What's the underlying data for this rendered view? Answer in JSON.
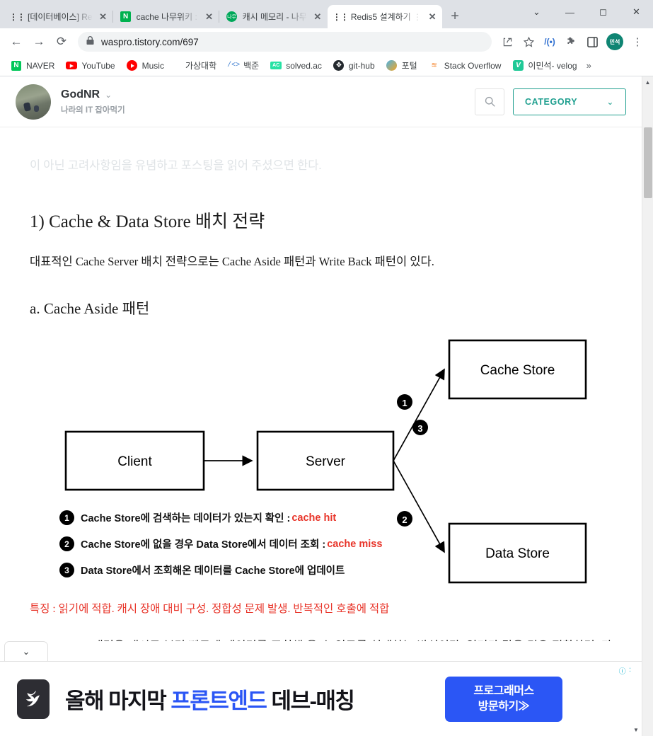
{
  "window": {
    "controls": {
      "collapse": "⌄",
      "minimize": "—",
      "maximize": "◻",
      "close": "✕"
    }
  },
  "tabs": [
    {
      "title": "[데이터베이스] Re",
      "favicon": "tistory-icon",
      "active": false,
      "close": "✕"
    },
    {
      "title": "cache 나무위키 :",
      "favicon": "namu-icon",
      "active": false,
      "close": "✕"
    },
    {
      "title": "캐시 메모리 - 나무",
      "favicon": "namu-green-icon",
      "active": false,
      "close": "✕"
    },
    {
      "title": "Redis5 설계하기 ⋮",
      "favicon": "tistory-icon",
      "active": true,
      "close": "✕"
    }
  ],
  "newtab_label": "+",
  "toolbar": {
    "back": "←",
    "forward": "→",
    "reload": "⟳",
    "lock": "🔒",
    "url": "waspro.tistory.com/697",
    "share": "share-icon",
    "bookmark_star": "★",
    "extension_one": "translate-icon",
    "extension_puzzle": "puzzle-icon",
    "sidepanel": "panel-icon",
    "profile_initials": "민석",
    "menu": "⋮"
  },
  "bookmarks": [
    {
      "label": "NAVER",
      "icon": "naver-icon"
    },
    {
      "label": "YouTube",
      "icon": "youtube-icon"
    },
    {
      "label": "Music",
      "icon": "youtube-music-icon"
    },
    {
      "label": "가상대학",
      "icon": "none"
    },
    {
      "label": "백준",
      "icon": "code-icon"
    },
    {
      "label": "solved.ac",
      "icon": "solvedac-icon"
    },
    {
      "label": "git-hub",
      "icon": "github-icon"
    },
    {
      "label": "포털",
      "icon": "portal-icon"
    },
    {
      "label": "Stack Overflow",
      "icon": "stackoverflow-icon"
    },
    {
      "label": "이민석- velog",
      "icon": "velog-icon"
    }
  ],
  "bookmarks_overflow": "»",
  "blog": {
    "author": "GodNR",
    "author_chevron": "⌄",
    "subtitle": "나라의 IT 잡아먹기",
    "search_icon": "search-icon",
    "category_label": "CATEGORY",
    "category_chevron": "⌄",
    "ghost_text": "이 아닌 고려사항임을 유념하고 포스팅을 읽어 주셨으면 한다."
  },
  "article": {
    "heading": "1) Cache & Data Store 배치 전략",
    "intro": "대표적인 Cache Server 배치 전략으로는 Cache Aside 패턴과 Write Back 패턴이 있다.",
    "subheading": "a. Cache Aside 패턴",
    "highlight": "특징 : 읽기에 적합. 캐시 장애 대비 구성. 정합성 문제 발생. 반복적인 호출에 적합",
    "body": "Cache Asdie 패턴은 캐시로 부터 빠르게 데이터를 조회해 올 수 있도록 설계하는 방식이다. 읽기가 많은 경우 적합하며, 가용성 측면에서 Cache 서버에 장애가 발생해도 Data Store를 통해 지속 서비스를 할 수 있다. 다만, Cache Store와 Data Store간 정합성 유지 문제가 발생할 수 있으며, 초기 조회 시 무조건 Data Store를 호출 해야 하므로 단건 호출 빈도가 높은 서비스에 적합하지 않다. 반복적으로 동일 쿼리를 수행하는 서비스에 적합한 아키텍처이다."
  },
  "diagram": {
    "nodes": [
      {
        "id": "client",
        "label": "Client"
      },
      {
        "id": "server",
        "label": "Server"
      },
      {
        "id": "cache_store",
        "label": "Cache Store"
      },
      {
        "id": "data_store",
        "label": "Data Store"
      }
    ],
    "edge_markers": [
      "1",
      "3",
      "2"
    ],
    "legend": [
      {
        "num": "1",
        "text": "Cache Store에 검색하는 데이터가 있는지 확인 : ",
        "accent": "cache hit"
      },
      {
        "num": "2",
        "text": "Cache Store에 없을 경우 Data Store에서 데이터 조회 : ",
        "accent": "cache miss"
      },
      {
        "num": "3",
        "text": "Data Store에서 조회해온 데이터를 Cache Store에 업데이트",
        "accent": ""
      }
    ],
    "accent_color": "#e8352a"
  },
  "ad": {
    "collapse_chevron": "⌄",
    "info_icon": "ⓘ",
    "close_icon": "✕",
    "logo": "bird-icon",
    "text_1": "올해 마지막 ",
    "text_blue": "프론트엔드",
    "text_2": " 데브-매칭",
    "cta_line1": "프로그래머스",
    "cta_line2": "방문하기≫"
  },
  "colors": {
    "brand_teal": "#21a090",
    "ad_blue": "#2b56f5",
    "accent_red": "#e8352a",
    "chrome_bg": "#dee1e6"
  }
}
